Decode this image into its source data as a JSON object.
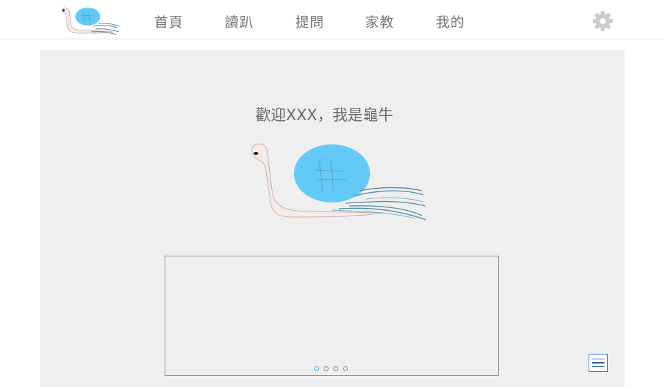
{
  "nav": {
    "items": [
      {
        "label": "首頁"
      },
      {
        "label": "讀趴"
      },
      {
        "label": "提問"
      },
      {
        "label": "家教"
      },
      {
        "label": "我的"
      }
    ]
  },
  "icons": {
    "logo": "snail-logo-icon",
    "settings": "gear-icon",
    "menu": "hamburger-menu-icon"
  },
  "main": {
    "welcome": "歡迎XXX，我是龜牛"
  },
  "carousel": {
    "slide_count": 4,
    "active_index": 0
  },
  "colors": {
    "shell": "#63caf7",
    "body": "#f7ebe6",
    "gear": "#cccccc",
    "panel": "#efefef"
  }
}
